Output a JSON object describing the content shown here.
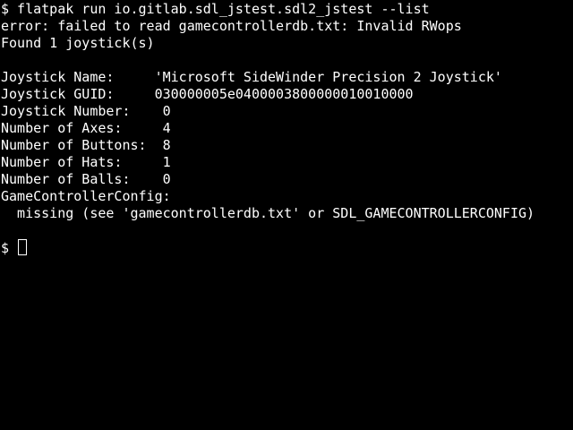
{
  "colors": {
    "background": "#000000",
    "foreground": "#ffffff"
  },
  "terminal": {
    "lines": [
      "$ flatpak run io.gitlab.sdl_jstest.sdl2_jstest --list",
      "error: failed to read gamecontrollerdb.txt: Invalid RWops",
      "Found 1 joystick(s)",
      "",
      "Joystick Name:     'Microsoft SideWinder Precision 2 Joystick'",
      "Joystick GUID:     030000005e0400003800000010010000",
      "Joystick Number:    0",
      "Number of Axes:     4",
      "Number of Buttons:  8",
      "Number of Hats:     1",
      "Number of Balls:    0",
      "GameControllerConfig:",
      "  missing (see 'gamecontrollerdb.txt' or SDL_GAMECONTROLLERCONFIG)",
      ""
    ],
    "prompt": "$ ",
    "cursor_icon": "block-cursor-icon"
  }
}
